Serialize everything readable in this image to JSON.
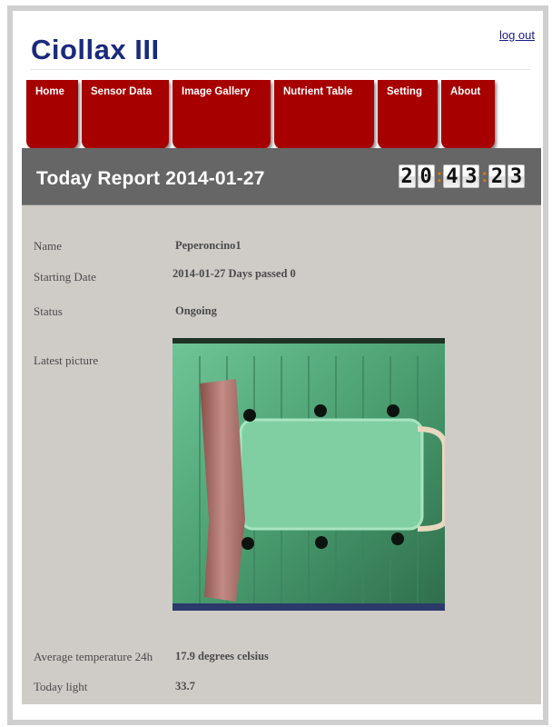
{
  "header": {
    "logout_label": "log out",
    "brand": "Ciollax III"
  },
  "nav": {
    "tabs": [
      {
        "label": "Home"
      },
      {
        "label": "Sensor Data"
      },
      {
        "label": "Image Gallery"
      },
      {
        "label": "Nutrient Table"
      },
      {
        "label": "Setting"
      },
      {
        "label": "About"
      }
    ]
  },
  "report": {
    "title": "Today Report 2014-01-27",
    "clock": {
      "h1": "2",
      "h2": "0",
      "m1": "4",
      "m2": "3",
      "s1": "2",
      "s2": "3"
    }
  },
  "details": {
    "name_label": "Name",
    "name_value": "Peperoncino1",
    "start_label": "Starting Date",
    "start_value": "2014-01-27 Days passed 0",
    "status_label": "Status",
    "status_value": "Ongoing",
    "picture_label": "Latest picture",
    "temp_label": "Average temperature 24h",
    "temp_value": "17.9 degrees celsius",
    "light_label": "Today light",
    "light_value": "33.7"
  },
  "colors": {
    "brand": "#1a2a7c",
    "tab_bg": "#a70000",
    "banner_bg": "#666666",
    "panel_bg": "#cfccc8",
    "clock_colon": "#e07a00"
  },
  "icons": [
    "plant-tray-photo"
  ]
}
